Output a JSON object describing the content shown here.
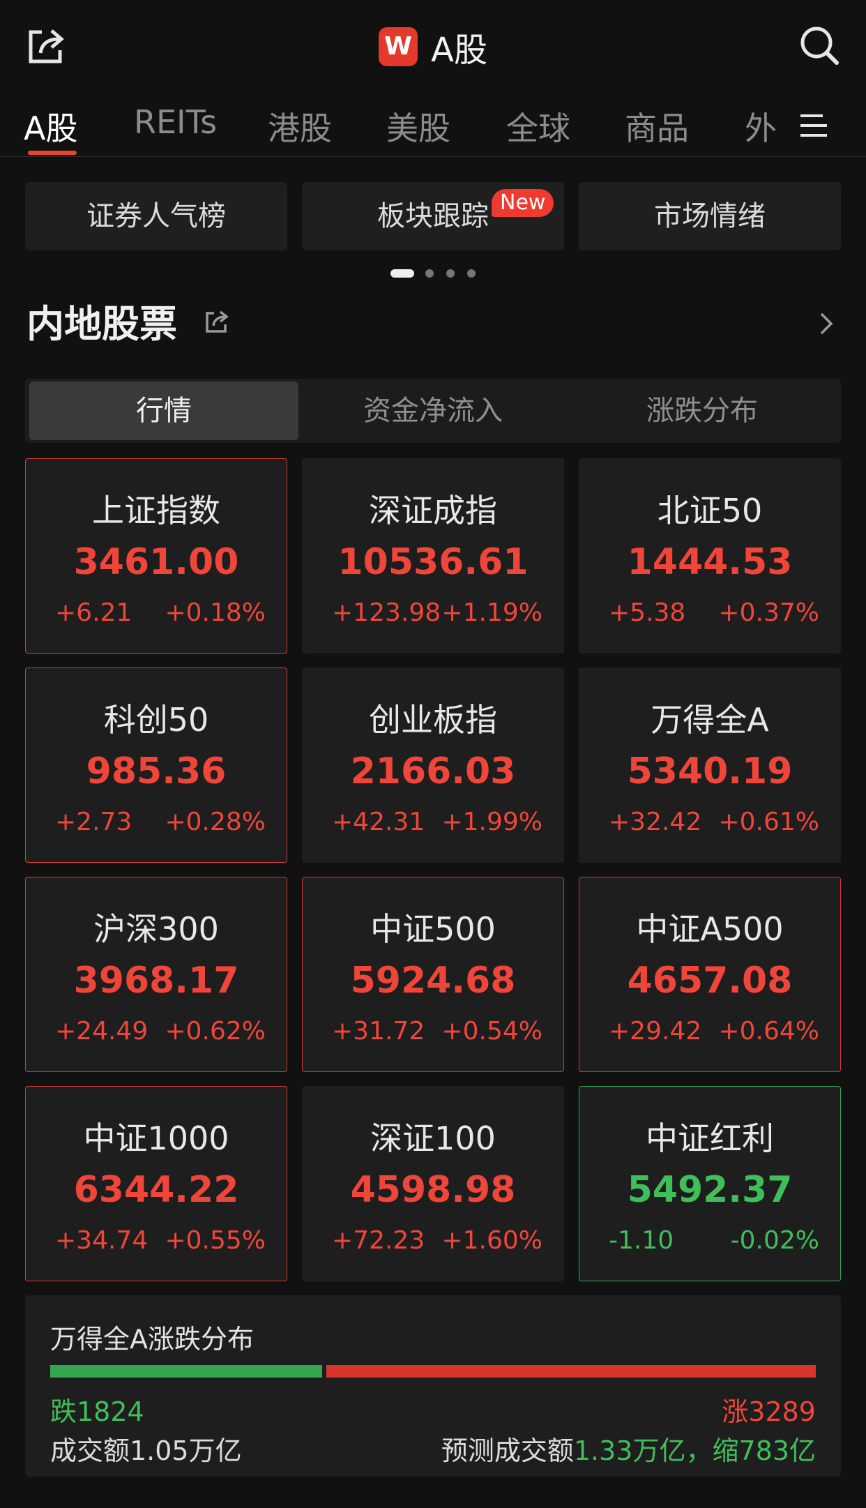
{
  "header": {
    "logo_text": "W",
    "title": "A股",
    "share_icon": "share-icon",
    "search_icon": "search-icon"
  },
  "tabs": [
    {
      "label": "A股",
      "active": true
    },
    {
      "label": "REITs"
    },
    {
      "label": "港股"
    },
    {
      "label": "美股"
    },
    {
      "label": "全球"
    },
    {
      "label": "商品"
    },
    {
      "label": "外"
    }
  ],
  "quick_buttons": [
    {
      "label": "证券人气榜"
    },
    {
      "label": "板块跟踪",
      "badge": "New"
    },
    {
      "label": "市场情绪"
    }
  ],
  "pager": {
    "count": 4,
    "active": 0
  },
  "section": {
    "title": "内地股票"
  },
  "segments": [
    {
      "label": "行情",
      "active": true
    },
    {
      "label": "资金净流入"
    },
    {
      "label": "涨跌分布"
    }
  ],
  "indices": [
    {
      "name": "上证指数",
      "price": "3461.00",
      "change": "+6.21",
      "pct": "+0.18%",
      "direction": "up",
      "bordered": true
    },
    {
      "name": "深证成指",
      "price": "10536.61",
      "change": "+123.98",
      "pct": "+1.19%",
      "direction": "up",
      "bordered": false
    },
    {
      "name": "北证50",
      "price": "1444.53",
      "change": "+5.38",
      "pct": "+0.37%",
      "direction": "up",
      "bordered": false
    },
    {
      "name": "科创50",
      "price": "985.36",
      "change": "+2.73",
      "pct": "+0.28%",
      "direction": "up",
      "bordered": true
    },
    {
      "name": "创业板指",
      "price": "2166.03",
      "change": "+42.31",
      "pct": "+1.99%",
      "direction": "up",
      "bordered": false
    },
    {
      "name": "万得全A",
      "price": "5340.19",
      "change": "+32.42",
      "pct": "+0.61%",
      "direction": "up",
      "bordered": false
    },
    {
      "name": "沪深300",
      "price": "3968.17",
      "change": "+24.49",
      "pct": "+0.62%",
      "direction": "up",
      "bordered": true
    },
    {
      "name": "中证500",
      "price": "5924.68",
      "change": "+31.72",
      "pct": "+0.54%",
      "direction": "up",
      "bordered": true
    },
    {
      "name": "中证A500",
      "price": "4657.08",
      "change": "+29.42",
      "pct": "+0.64%",
      "direction": "up",
      "bordered": true
    },
    {
      "name": "中证1000",
      "price": "6344.22",
      "change": "+34.74",
      "pct": "+0.55%",
      "direction": "up",
      "bordered": true
    },
    {
      "name": "深证100",
      "price": "4598.98",
      "change": "+72.23",
      "pct": "+1.60%",
      "direction": "up",
      "bordered": false
    },
    {
      "name": "中证红利",
      "price": "5492.37",
      "change": "-1.10",
      "pct": "-0.02%",
      "direction": "down",
      "bordered": true
    }
  ],
  "distribution": {
    "title": "万得全A涨跌分布",
    "down_label": "跌1824",
    "up_label": "涨3289",
    "down_count": 1824,
    "up_count": 3289,
    "turnover": "成交额1.05万亿",
    "forecast_prefix": "预测成交额",
    "forecast_value": "1.33万亿，缩783亿"
  },
  "colors": {
    "up": "#f0463a",
    "down": "#3fbf5a",
    "accent": "#e8452f"
  }
}
